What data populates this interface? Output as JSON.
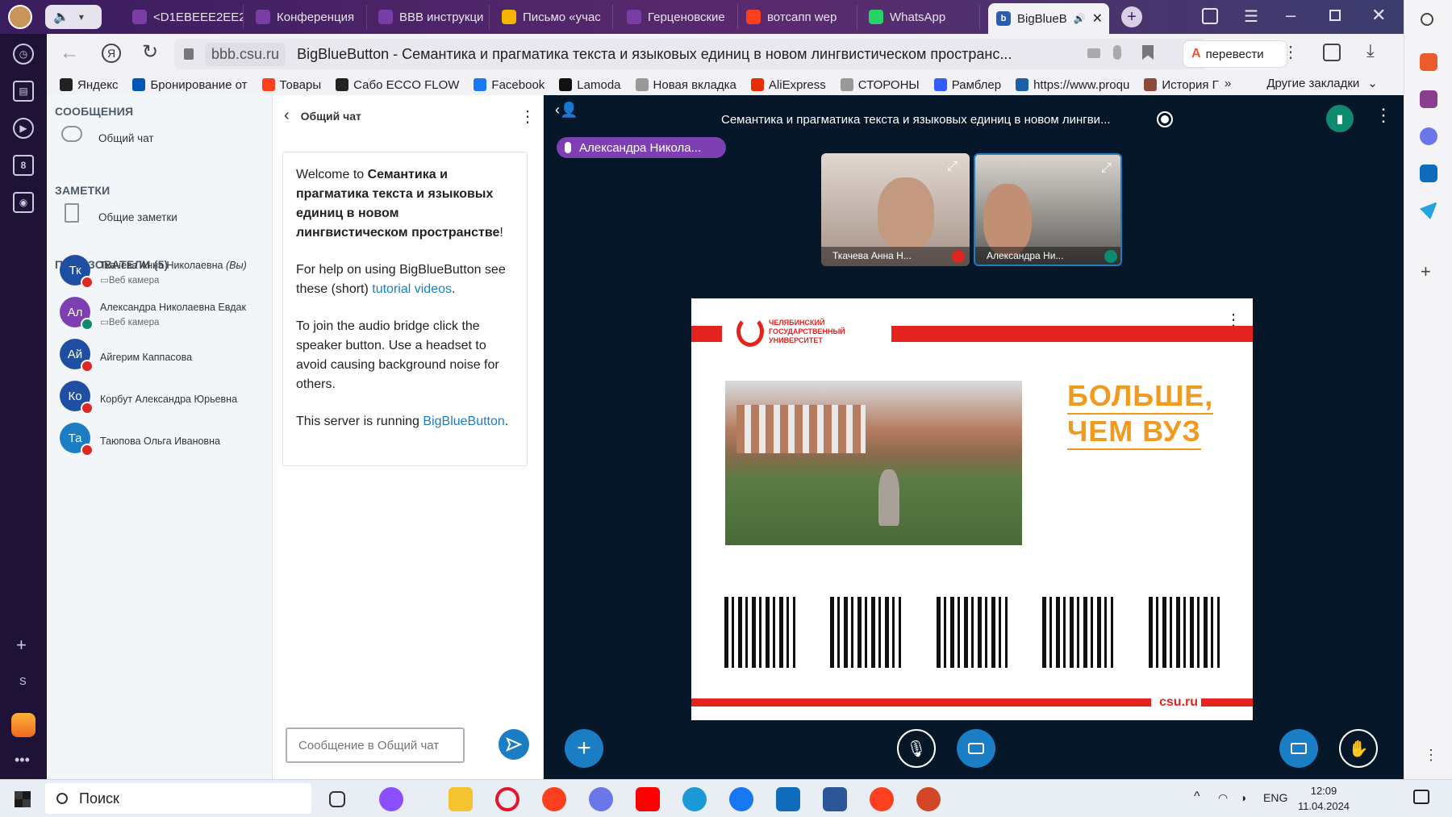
{
  "browser": {
    "tabs": [
      {
        "label": "<D1EBEEE2EE2",
        "color": "#7a3da5"
      },
      {
        "label": "Конференция",
        "color": "#7a3da5"
      },
      {
        "label": "BBB инструкци",
        "color": "#7a3da5"
      },
      {
        "label": "Письмо «учас",
        "color": "#f5b400"
      },
      {
        "label": "Герценовские",
        "color": "#7a3da5"
      },
      {
        "label": "вотсапп wep",
        "color": "#fc3f1d"
      },
      {
        "label": "WhatsApp",
        "color": "#25d366"
      }
    ],
    "active_tab": "BigBlueB",
    "address_domain": "bbb.csu.ru",
    "page_title": "BigBlueButton - Семантика и прагматика текста и языковых единиц в новом лингвистическом пространс...",
    "translate_label": "перевести",
    "bookmarks": [
      {
        "label": "Яндекс",
        "color": "#222"
      },
      {
        "label": "Бронирование от",
        "color": "#0057b8"
      },
      {
        "label": "Товары",
        "color": "#fc3f1d"
      },
      {
        "label": "Сабо ECCO FLOW",
        "color": "#222"
      },
      {
        "label": "Facebook",
        "color": "#1877f2"
      },
      {
        "label": "Lamoda",
        "color": "#111"
      },
      {
        "label": "Новая вкладка",
        "color": "#999"
      },
      {
        "label": "AliExpress",
        "color": "#e62e04"
      },
      {
        "label": "СТОРОНЫ",
        "color": "#999"
      },
      {
        "label": "Рамблер",
        "color": "#315efb"
      },
      {
        "label": "https://www.proqu",
        "color": "#1b5fa8"
      },
      {
        "label": "История Г",
        "color": "#8a4b3b"
      }
    ],
    "bookmarks_more": "Другие закладки"
  },
  "left_sidebar": {
    "messages_title": "СООБЩЕНИЯ",
    "public_chat": "Общий чат",
    "notes_title": "ЗАМЕТКИ",
    "shared_notes": "Общие заметки",
    "users_title": "ПОЛЬЗОВАТЕЛИ (5)",
    "users": [
      {
        "initials": "Тк",
        "name": "Ткачева Анна Николаевна",
        "you": "(Вы)",
        "sub": "Веб камера",
        "color": "#1f4fa3",
        "badge": "#df2721"
      },
      {
        "initials": "Ал",
        "name": "Александра Николаевна Евдак",
        "you": "",
        "sub": "Веб камера",
        "color": "#7e3fb3",
        "badge": "#0f8a6e"
      },
      {
        "initials": "Ай",
        "name": "Айгерим Каппасова",
        "you": "",
        "sub": "",
        "color": "#1f4fa3",
        "badge": "#df2721"
      },
      {
        "initials": "Ко",
        "name": "Корбут Александра Юрьевна",
        "you": "",
        "sub": "",
        "color": "#1f4fa3",
        "badge": "#df2721"
      },
      {
        "initials": "Та",
        "name": "Таюпова Ольга Ивановна",
        "you": "",
        "sub": "",
        "color": "#1b7dc3",
        "badge": "#df2721"
      }
    ]
  },
  "chat": {
    "header": "Общий чат",
    "welcome_prefix": "Welcome to ",
    "welcome_title": "Семантика и прагматика текста и языковых единиц в новом лингвистическом пространстве",
    "welcome_suffix": "!",
    "help_text_1": "For help on using BigBlueButton see these (short) ",
    "help_link": "tutorial videos",
    "help_text_2": ".",
    "audio_text": "To join the audio bridge click the speaker button. Use a headset to avoid causing background noise for others.",
    "server_text": "This server is running ",
    "server_link": "BigBlueButton",
    "server_suffix": ".",
    "input_placeholder": "Сообщение в Общий чат"
  },
  "main": {
    "meeting_title": "Семантика и прагматика текста и языковых единиц в новом лингви...",
    "talking_indicator": "Александра Никола...",
    "cameras": [
      {
        "name": "Ткачева Анна Н..."
      },
      {
        "name": "Александра Ни..."
      }
    ],
    "slide": {
      "logo_text": "ЧЕЛЯБИНСКИЙ ГОСУДАРСТВЕННЫЙ УНИВЕРСИТЕТ",
      "slogan_line1": "БОЛЬШЕ,",
      "slogan_line2": "ЧЕМ ВУЗ",
      "footer_url": "csu.ru"
    }
  },
  "right_sidebar": {
    "bottom_letter": "S"
  },
  "taskbar": {
    "search": "Поиск",
    "language": "ENG",
    "time": "12:09",
    "date": "11.04.2024"
  }
}
